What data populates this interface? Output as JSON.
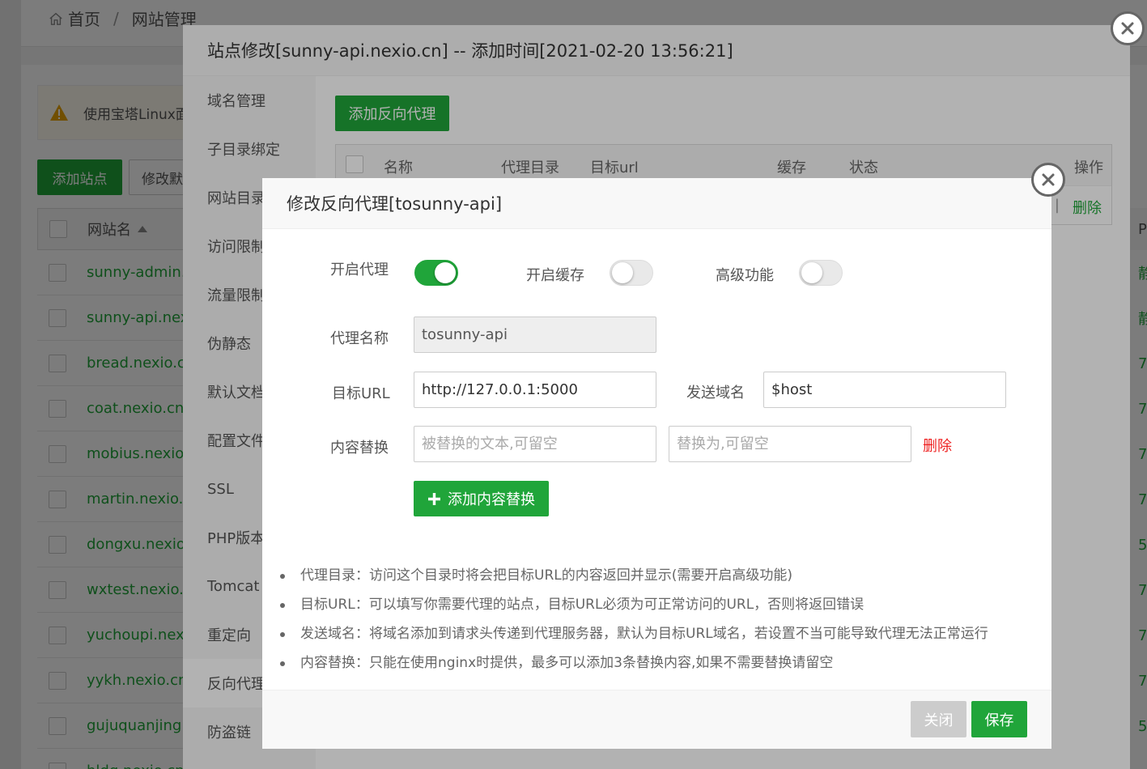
{
  "colors": {
    "accent_green": "#20a53a",
    "danger_red": "#ee2222",
    "overlay": "rgba(0,0,0,0.3)"
  },
  "background": {
    "breadcrumb": {
      "home": "首页",
      "separator": "/",
      "current": "网站管理"
    },
    "alert_text": "使用宝塔Linux面",
    "buttons": {
      "add_site": "添加站点",
      "modify_default": "修改默"
    },
    "table": {
      "header_name": "网站名",
      "rows": [
        "sunny-admin.",
        "sunny-api.nex",
        "bread.nexio.cr",
        "coat.nexio.cn",
        "mobius.nexio.",
        "martin.nexio.c",
        "dongxu.nexio.",
        "wxtest.nexio.c",
        "yuchoupi.nexi",
        "yykh.nexio.cn",
        "gujuquanjing.",
        "hldg.nexio.cn"
      ],
      "right_col_header": "P",
      "right_col": [
        "静",
        "静",
        "7",
        "7",
        "7",
        "7",
        "5",
        "7",
        "7",
        "7",
        "5",
        ""
      ]
    }
  },
  "site_dialog": {
    "title": "站点修改[sunny-api.nexio.cn] -- 添加时间[2021-02-20 13:56:21]",
    "menu": [
      "域名管理",
      "子目录绑定",
      "网站目录",
      "访问限制",
      "流量限制",
      "伪静态",
      "默认文档",
      "配置文件",
      "SSL",
      "PHP版本",
      "Tomcat",
      "重定向",
      "反向代理",
      "防盗链"
    ],
    "active_menu": "反向代理",
    "add_proxy_button": "添加反向代理",
    "proxy_table": {
      "headers": {
        "name": "名称",
        "proxy_dir": "代理目录",
        "target_url": "目标url",
        "cache": "缓存",
        "status": "状态",
        "action": "操作"
      },
      "row_separator": "|",
      "row_delete": "删除"
    }
  },
  "proxy_dialog": {
    "title": "修改反向代理[tosunny-api]",
    "switches": {
      "enable_proxy": {
        "label": "开启代理",
        "on": true
      },
      "enable_cache": {
        "label": "开启缓存",
        "on": false
      },
      "advanced": {
        "label": "高级功能",
        "on": false
      }
    },
    "proxy_name": {
      "label": "代理名称",
      "value": "tosunny-api"
    },
    "target_url": {
      "label": "目标URL",
      "value": "http://127.0.0.1:5000"
    },
    "send_domain": {
      "label": "发送域名",
      "value": "$host"
    },
    "content_replace": {
      "label": "内容替换",
      "from_placeholder": "被替换的文本,可留空",
      "to_placeholder": "替换为,可留空",
      "delete": "删除"
    },
    "add_replace_button": "添加内容替换",
    "tips": [
      "代理目录：访问这个目录时将会把目标URL的内容返回并显示(需要开启高级功能)",
      "目标URL：可以填写你需要代理的站点，目标URL必须为可正常访问的URL，否则将返回错误",
      "发送域名：将域名添加到请求头传递到代理服务器，默认为目标URL域名，若设置不当可能导致代理无法正常运行",
      "内容替换：只能在使用nginx时提供，最多可以添加3条替换内容,如果不需要替换请留空"
    ],
    "footer": {
      "close": "关闭",
      "save": "保存"
    }
  }
}
